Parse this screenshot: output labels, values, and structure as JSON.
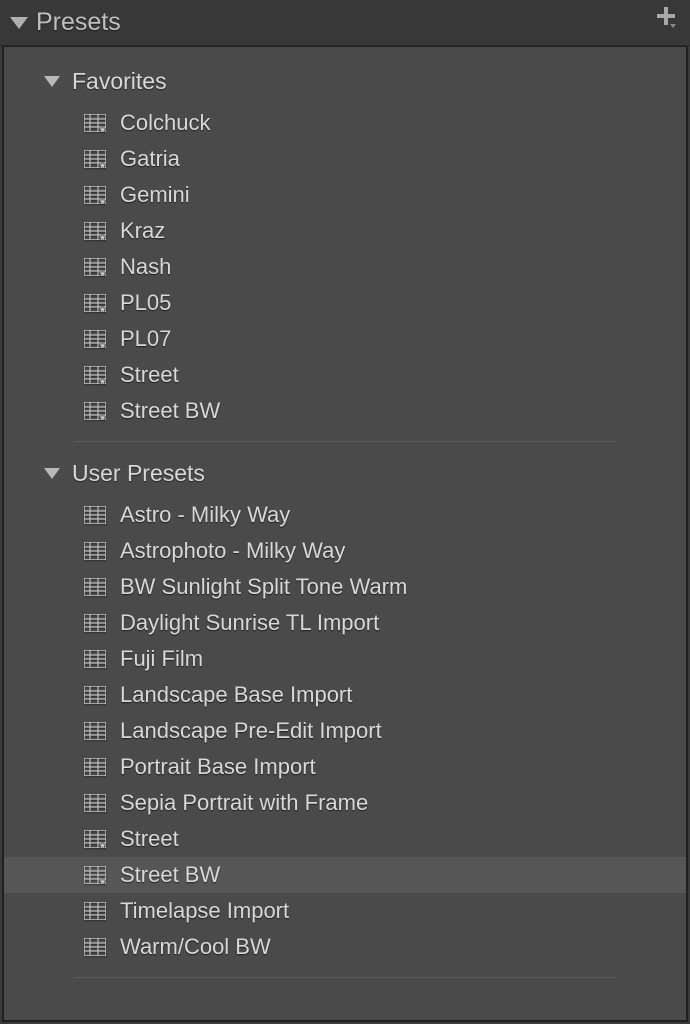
{
  "panel": {
    "title": "Presets"
  },
  "groups": [
    {
      "name": "Favorites",
      "expanded": true,
      "items": [
        {
          "label": "Colchuck",
          "favorite": true,
          "selected": false
        },
        {
          "label": "Gatria",
          "favorite": true,
          "selected": false
        },
        {
          "label": "Gemini",
          "favorite": true,
          "selected": false
        },
        {
          "label": "Kraz",
          "favorite": true,
          "selected": false
        },
        {
          "label": "Nash",
          "favorite": true,
          "selected": false
        },
        {
          "label": "PL05",
          "favorite": true,
          "selected": false
        },
        {
          "label": "PL07",
          "favorite": true,
          "selected": false
        },
        {
          "label": "Street",
          "favorite": true,
          "selected": false
        },
        {
          "label": "Street BW",
          "favorite": true,
          "selected": false
        }
      ]
    },
    {
      "name": "User Presets",
      "expanded": true,
      "items": [
        {
          "label": "Astro - Milky Way",
          "favorite": false,
          "selected": false
        },
        {
          "label": "Astrophoto - Milky Way",
          "favorite": false,
          "selected": false
        },
        {
          "label": "BW Sunlight Split Tone Warm",
          "favorite": false,
          "selected": false
        },
        {
          "label": "Daylight Sunrise TL Import",
          "favorite": false,
          "selected": false
        },
        {
          "label": "Fuji Film",
          "favorite": false,
          "selected": false
        },
        {
          "label": "Landscape Base Import",
          "favorite": false,
          "selected": false
        },
        {
          "label": "Landscape Pre-Edit Import",
          "favorite": false,
          "selected": false
        },
        {
          "label": "Portrait Base Import",
          "favorite": false,
          "selected": false
        },
        {
          "label": "Sepia Portrait with Frame",
          "favorite": false,
          "selected": false
        },
        {
          "label": "Street",
          "favorite": true,
          "selected": false
        },
        {
          "label": "Street BW",
          "favorite": true,
          "selected": true
        },
        {
          "label": "Timelapse Import",
          "favorite": false,
          "selected": false
        },
        {
          "label": "Warm/Cool BW",
          "favorite": false,
          "selected": false
        }
      ]
    }
  ]
}
